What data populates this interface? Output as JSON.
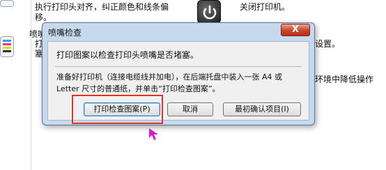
{
  "background": {
    "item1_lines": [
      "执行打印头对齐，纠正颜色和线条偏",
      "移。"
    ],
    "item2_fragments": [
      "喷嘴",
      "打",
      "塞"
    ],
    "power_item_label": "关闭打印机。",
    "settings_fragment": "设置。",
    "env_fragment": "环境中降低操作"
  },
  "dialog": {
    "title": "喷嘴检查",
    "close_label": "X",
    "heading": "打印图案以检查打印头喷嘴是否堵塞。",
    "instruction": "准备好打印机（连接电缆线并加电），在后端托盘中装入一张 A4 或 Letter 尺寸的普通纸，并单击“打印检查图案”。",
    "buttons": {
      "print": "打印检查图案(P)",
      "cancel": "取消",
      "initial": "最初确认项目(I)"
    }
  },
  "colors": {
    "highlight": "#e2322a",
    "arrow": "#d01fc8"
  },
  "icons": [
    "printer-icon",
    "color-bars-icon",
    "power-icon",
    "cursor-arrow-icon"
  ]
}
